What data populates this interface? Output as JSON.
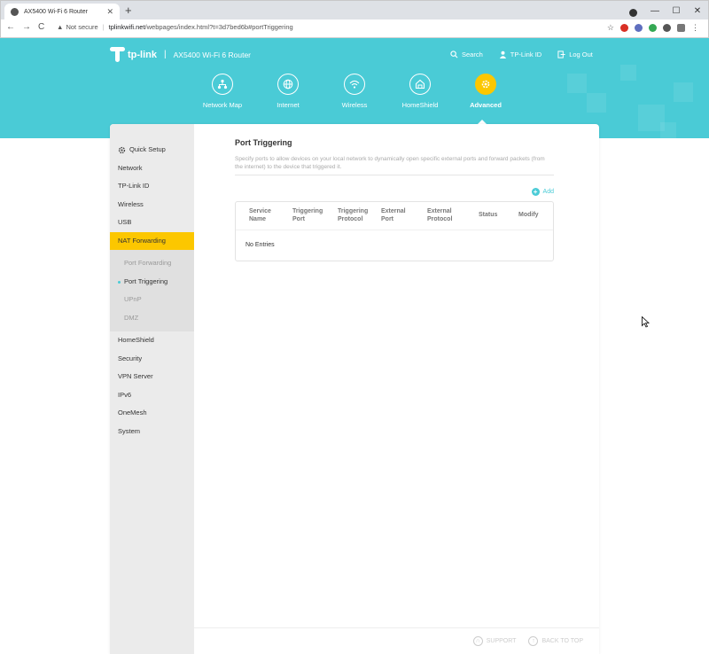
{
  "browser": {
    "tab_title": "AX5400 Wi-Fi 6 Router",
    "tab_close": "✕",
    "new_tab": "+",
    "back": "←",
    "forward": "→",
    "reload": "C",
    "not_secure": "Not secure",
    "url_host": "tplinkwifi.net",
    "url_path": "/webpages/index.html?t=3d7bed6b#portTriggering",
    "minimize": "—",
    "maximize": "☐",
    "close": "✕"
  },
  "header": {
    "brand": "tp-link",
    "model": "AX5400 Wi-Fi 6 Router",
    "links": {
      "search": "Search",
      "tplink_id": "TP-Link ID",
      "logout": "Log Out"
    }
  },
  "mainnav": [
    {
      "label": "Network Map",
      "icon": "network-map-icon"
    },
    {
      "label": "Internet",
      "icon": "globe-icon"
    },
    {
      "label": "Wireless",
      "icon": "wifi-icon"
    },
    {
      "label": "HomeShield",
      "icon": "home-shield-icon"
    },
    {
      "label": "Advanced",
      "icon": "gear-icon",
      "active": true
    }
  ],
  "sidebar": {
    "items_top": [
      {
        "label": "Quick Setup"
      },
      {
        "label": "Network"
      },
      {
        "label": "TP-Link ID"
      },
      {
        "label": "Wireless"
      },
      {
        "label": "USB"
      },
      {
        "label": "NAT Forwarding"
      }
    ],
    "sub_items": [
      {
        "label": "Port Forwarding"
      },
      {
        "label": "Port Triggering"
      },
      {
        "label": "UPnP"
      },
      {
        "label": "DMZ"
      }
    ],
    "items_bottom": [
      {
        "label": "HomeShield"
      },
      {
        "label": "Security"
      },
      {
        "label": "VPN Server"
      },
      {
        "label": "IPv6"
      },
      {
        "label": "OneMesh"
      },
      {
        "label": "System"
      }
    ]
  },
  "page": {
    "title": "Port Triggering",
    "description": "Specify ports to allow devices on your local network to dynamically open specific external ports and forward packets (from the internet) to the device that triggered it.",
    "add_label": "Add",
    "table": {
      "columns": [
        [
          "Service",
          "Name"
        ],
        [
          "Triggering",
          "Port"
        ],
        [
          "Triggering",
          "Protocol"
        ],
        [
          "External",
          "Port"
        ],
        [
          "External",
          "Protocol"
        ],
        [
          "Status",
          ""
        ],
        [
          "Modify",
          ""
        ]
      ],
      "empty_text": "No Entries"
    }
  },
  "footer": {
    "support": "SUPPORT",
    "back_to_top": "BACK TO TOP"
  },
  "colors": {
    "header_bg": "#4acbd6",
    "accent_yellow": "#fcc700"
  }
}
